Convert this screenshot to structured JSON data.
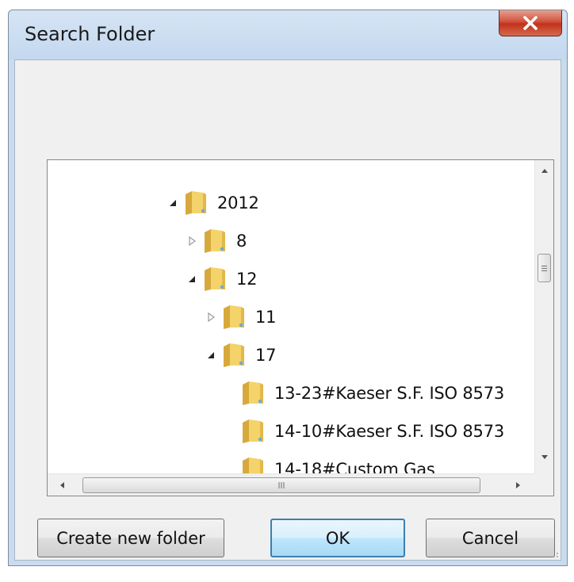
{
  "window": {
    "title": "Search Folder",
    "close_glyph": "X"
  },
  "tree": {
    "nodes": [
      {
        "label": "2012",
        "expander": "expanded"
      },
      {
        "label": "8",
        "expander": "collapsed"
      },
      {
        "label": "12",
        "expander": "expanded"
      },
      {
        "label": "11",
        "expander": "collapsed"
      },
      {
        "label": "17",
        "expander": "expanded"
      },
      {
        "label": "13-23#Kaeser S.F. ISO 8573",
        "expander": "none"
      },
      {
        "label": "14-10#Kaeser S.F. ISO 8573",
        "expander": "none"
      },
      {
        "label": "14-18#Custom Gas",
        "expander": "none"
      }
    ]
  },
  "buttons": {
    "create_new_folder": "Create new folder",
    "ok": "OK",
    "cancel": "Cancel"
  },
  "icons": {
    "folder": "folder-icon",
    "expanded": "expanded-triangle-icon",
    "collapsed": "collapsed-triangle-icon",
    "scroll_up": "scroll-up-arrow-icon",
    "scroll_down": "scroll-down-arrow-icon",
    "scroll_left": "scroll-left-arrow-icon",
    "scroll_right": "scroll-right-arrow-icon"
  },
  "colors": {
    "title_bar": "#c9dbef",
    "close_button": "#c8432c",
    "default_button_border": "#3c7fb1",
    "folder": "#f2cc55"
  }
}
